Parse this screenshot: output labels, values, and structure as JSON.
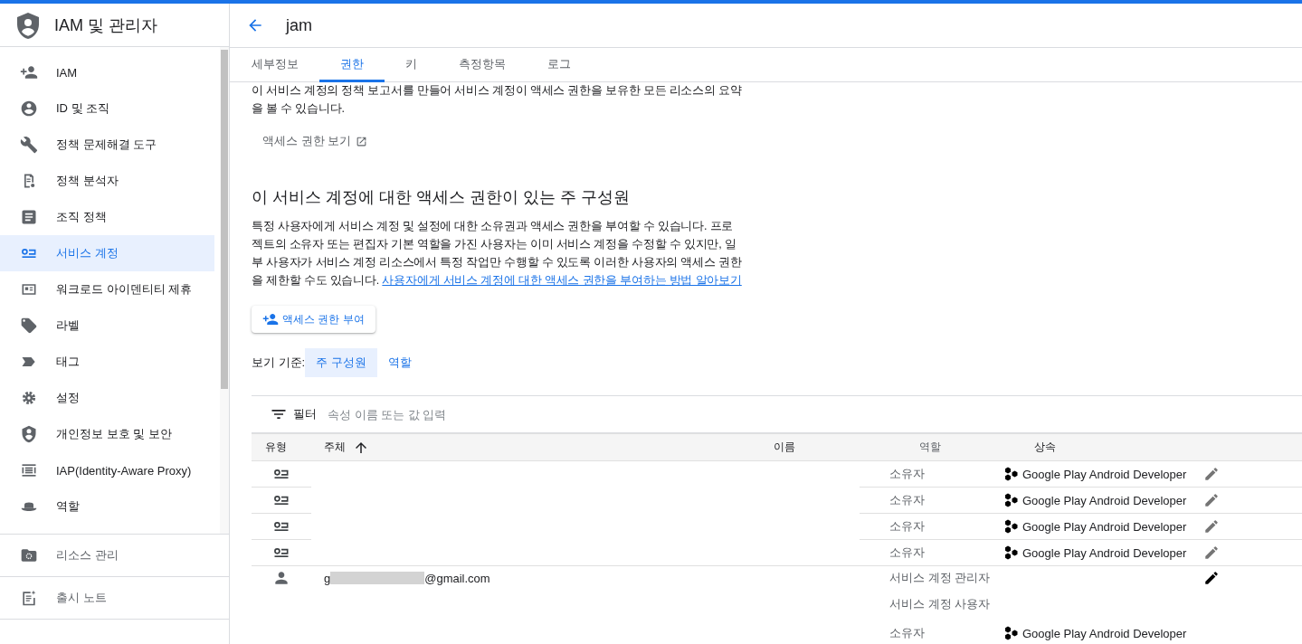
{
  "product": {
    "title": "IAM 및 관리자"
  },
  "sidebar": {
    "items": [
      {
        "label": "IAM",
        "selected": false
      },
      {
        "label": "ID 및 조직",
        "selected": false
      },
      {
        "label": "정책 문제해결 도구",
        "selected": false
      },
      {
        "label": "정책 분석자",
        "selected": false
      },
      {
        "label": "조직 정책",
        "selected": false
      },
      {
        "label": "서비스 계정",
        "selected": true
      },
      {
        "label": "워크로드 아이덴티티 제휴",
        "selected": false
      },
      {
        "label": "라벨",
        "selected": false
      },
      {
        "label": "태그",
        "selected": false
      },
      {
        "label": "설정",
        "selected": false
      },
      {
        "label": "개인정보 보호 및 보안",
        "selected": false
      },
      {
        "label": "IAP(Identity-Aware Proxy)",
        "selected": false
      },
      {
        "label": "역할",
        "selected": false
      }
    ],
    "sections": [
      {
        "label": "리소스 관리"
      },
      {
        "label": "출시 노트"
      }
    ]
  },
  "header": {
    "title": "jam"
  },
  "tabs": [
    {
      "label": "세부정보",
      "selected": false
    },
    {
      "label": "권한",
      "selected": true
    },
    {
      "label": "키",
      "selected": false
    },
    {
      "label": "측정항목",
      "selected": false
    },
    {
      "label": "로그",
      "selected": false
    }
  ],
  "intro_text": "이 서비스 계정의 정책 보고서를 만들어 서비스 계정이 액세스 권한을 보유한 모든 리소스의 요약을 볼 수 있습니다.",
  "view_access_link": "액세스 권한 보기",
  "section": {
    "heading": "이 서비스 계정에 대한 액세스 권한이 있는 주 구성원",
    "description": "특정 사용자에게 서비스 계정 및 설정에 대한 소유권과 액세스 권한을 부여할 수 있습니다. 프로젝트의 소유자 또는 편집자 기본 역할을 가진 사용자는 이미 서비스 계정을 수정할 수 있지만, 일부 사용자가 서비스 계정 리소스에서 특정 작업만 수행할 수 있도록 이러한 사용자의 액세스 권한을 제한할 수도 있습니다.",
    "link": "사용자에게 서비스 계정에 대한 액세스 권한을 부여하는 방법 알아보기"
  },
  "grant_button": "액세스 권한 부여",
  "view_by": {
    "label": "보기 기준:",
    "options": [
      {
        "label": "주 구성원",
        "selected": true
      },
      {
        "label": "역할",
        "selected": false
      }
    ]
  },
  "filter": {
    "label": "필터",
    "placeholder": "속성 이름 또는 값 입력"
  },
  "table": {
    "columns": [
      {
        "label": "유형",
        "sorted": false
      },
      {
        "label": "주체",
        "sorted": true
      },
      {
        "label": "이름",
        "sorted": false
      },
      {
        "label": "역할",
        "sorted": false
      },
      {
        "label": "상속",
        "sorted": false
      }
    ],
    "members": [
      {
        "kind": "service_account",
        "editable": false,
        "roles": [
          {
            "role": "소유자",
            "inherited_from": "Google Play Android Developer"
          }
        ]
      },
      {
        "kind": "service_account",
        "editable": false,
        "roles": [
          {
            "role": "소유자",
            "inherited_from": "Google Play Android Developer"
          }
        ]
      },
      {
        "kind": "service_account",
        "editable": false,
        "roles": [
          {
            "role": "소유자",
            "inherited_from": "Google Play Android Developer"
          }
        ]
      },
      {
        "kind": "service_account",
        "editable": false,
        "roles": [
          {
            "role": "소유자",
            "inherited_from": "Google Play Android Developer"
          }
        ]
      },
      {
        "kind": "user",
        "editable": true,
        "principal_start": "g",
        "redacted": true,
        "principal_end": "@gmail.com",
        "roles": [
          {
            "role": "서비스 계정 관리자"
          },
          {
            "role": "서비스 계정 사용자"
          },
          {
            "role": "소유자",
            "inherited_from": "Google Play Android Developer"
          }
        ]
      }
    ]
  }
}
